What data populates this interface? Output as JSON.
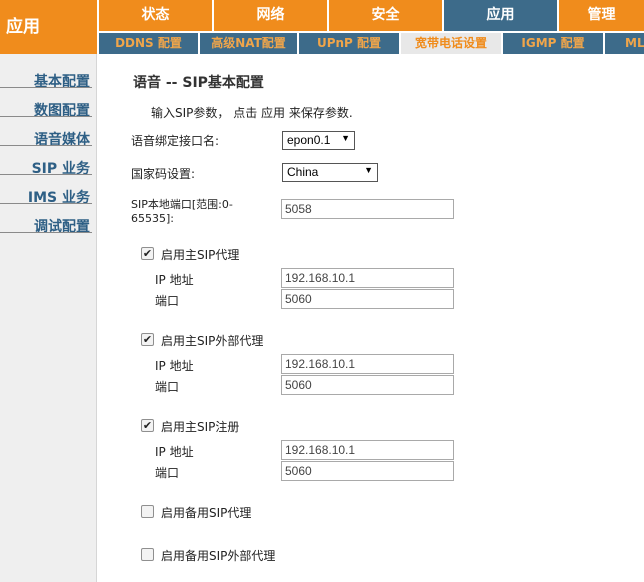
{
  "brand": {
    "title": "应用"
  },
  "main_nav": [
    {
      "label": "状态",
      "active": false
    },
    {
      "label": "网络",
      "active": false
    },
    {
      "label": "安全",
      "active": false
    },
    {
      "label": "应用",
      "active": true
    },
    {
      "label": "管理",
      "active": false
    }
  ],
  "sub_nav": [
    {
      "label": "DDNS 配置",
      "active": false
    },
    {
      "label": "高级NAT配置",
      "active": false
    },
    {
      "label": "UPnP 配置",
      "active": false
    },
    {
      "label": "宽带电话设置",
      "active": true
    },
    {
      "label": "IGMP 配置",
      "active": false
    },
    {
      "label": "ML",
      "active": false
    }
  ],
  "sidebar": {
    "items": [
      {
        "label": "基本配置"
      },
      {
        "label": "数图配置"
      },
      {
        "label": "语音媒体"
      },
      {
        "label": "SIP 业务"
      },
      {
        "label": "IMS 业务"
      },
      {
        "label": "调试配置"
      }
    ]
  },
  "content": {
    "title": "语音 -- SIP基本配置",
    "description": "输入SIP参数， 点击 应用 来保存参数.",
    "interface_label": "语音绑定接口名:",
    "interface_value": "epon0.1",
    "country_label": "国家码设置:",
    "country_value": "China",
    "local_port_label_1": "SIP本地端口[范围:0-",
    "local_port_label_2": "65535]:",
    "local_port_value": "5058",
    "proxy": {
      "checkbox_label": "启用主SIP代理",
      "checked": true,
      "ip_label": "IP 地址",
      "ip_value": "192.168.10.1",
      "port_label": "端口",
      "port_value": "5060"
    },
    "outbound_proxy": {
      "checkbox_label": "启用主SIP外部代理",
      "checked": true,
      "ip_label": "IP 地址",
      "ip_value": "192.168.10.1",
      "port_label": "端口",
      "port_value": "5060"
    },
    "registrar": {
      "checkbox_label": "启用主SIP注册",
      "checked": true,
      "ip_label": "IP 地址",
      "ip_value": "192.168.10.1",
      "port_label": "端口",
      "port_value": "5060"
    },
    "backup_proxy": {
      "checkbox_label": "启用备用SIP代理",
      "checked": false
    },
    "backup_outbound_proxy": {
      "checkbox_label": "启用备用SIP外部代理",
      "checked": false
    }
  },
  "colors": {
    "nav_orange": "#f08c1c",
    "nav_blue": "#3d6b8a",
    "sidebar_link": "#2e5f85",
    "sidebar_bg": "#efefef"
  }
}
